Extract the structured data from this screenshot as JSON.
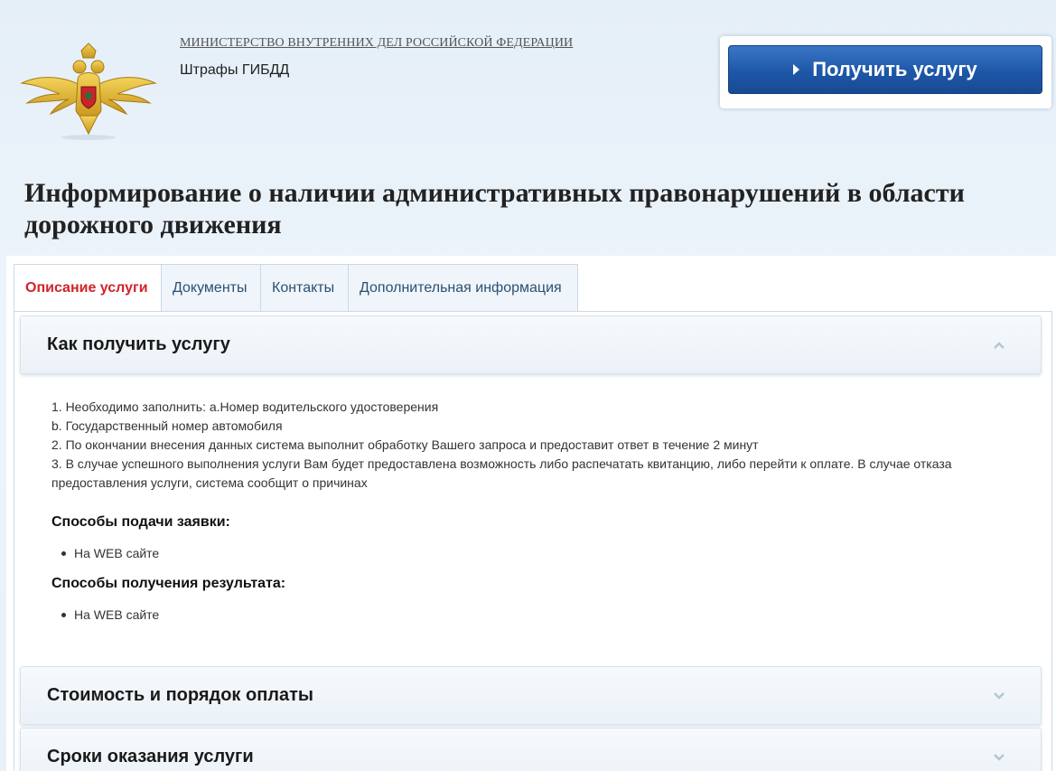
{
  "header": {
    "ministry": "МИНИСТЕРСТВО ВНУТРЕННИХ ДЕЛ РОССИЙСКОЙ ФЕДЕРАЦИИ",
    "subtitle": "Штрафы ГИБДД",
    "emblem_icon": "mvd-eagle-emblem-icon",
    "cta_label": "Получить услугу",
    "cta_icon": "triangle-right-icon"
  },
  "page_title": "Информирование о наличии административных правонарушений в области дорожного движения",
  "tabs": [
    {
      "label": "Описание услуги",
      "active": true
    },
    {
      "label": "Документы",
      "active": false
    },
    {
      "label": "Контакты",
      "active": false
    },
    {
      "label": "Дополнительная информация",
      "active": false
    }
  ],
  "accordion": [
    {
      "title": "Как получить услугу",
      "expanded": true,
      "icon": "chevron-up-icon"
    },
    {
      "title": "Стоимость и порядок оплаты",
      "expanded": false,
      "icon": "chevron-down-icon"
    },
    {
      "title": "Сроки оказания услуги",
      "expanded": false,
      "icon": "chevron-down-icon"
    }
  ],
  "how_to": {
    "lines": [
      "1. Необходимо заполнить: a.Номер водительского удостоверения",
      "b. Государственный номер автомобиля",
      "2. По окончании внесения данных система выполнит обработку Вашего запроса и предоставит ответ в течение 2 минут",
      "3. В случае успешного выполнения услуги Вам будет предоставлена возможность либо распечатать квитанцию, либо перейти к оплате. В случае отказа предоставления услуги, система сообщит о причинах"
    ],
    "submit_title": "Способы подачи заявки:",
    "submit_items": [
      "На WEB сайте"
    ],
    "result_title": "Способы получения результата:",
    "result_items": [
      "На WEB сайте"
    ]
  },
  "colors": {
    "accent_blue": "#1e57a8",
    "active_tab_red": "#d2232a",
    "tab_text": "#2d4f72",
    "page_bg": "#e9f2fa"
  }
}
